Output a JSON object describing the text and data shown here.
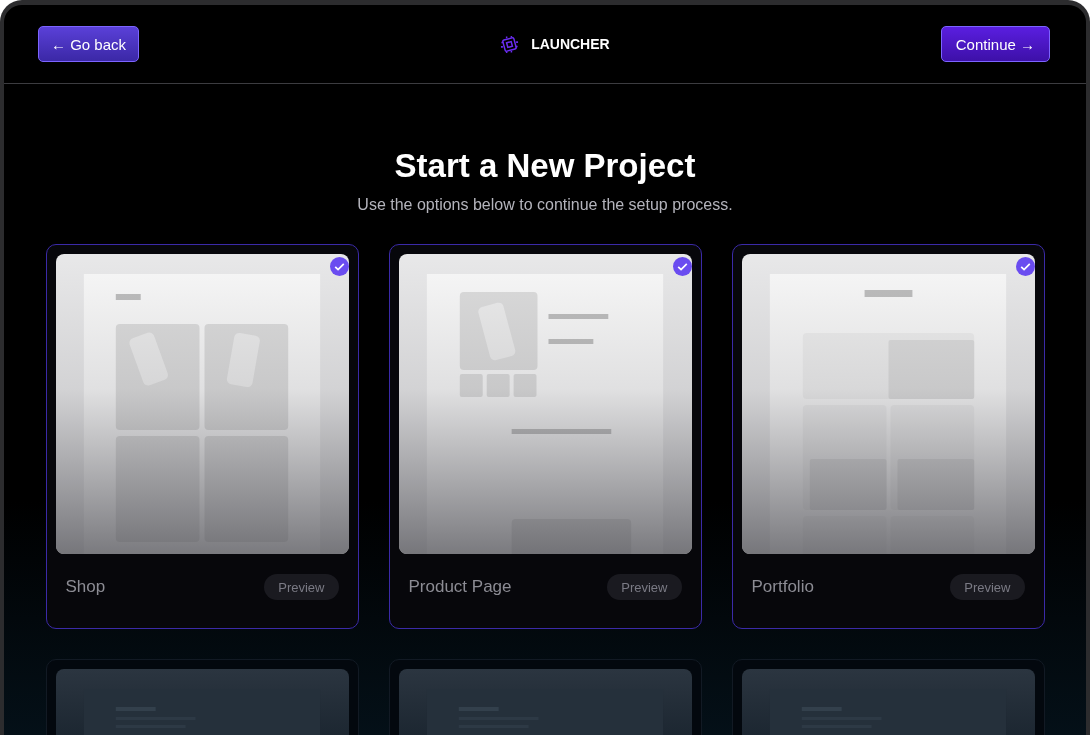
{
  "header": {
    "back_button": "← Go back",
    "logo": "LAUNCHER",
    "continue_button": "Continue →"
  },
  "title": "Start a New Project",
  "subtitle": "Use the options below to continue the setup process.",
  "projects": [
    {
      "name": "Shop",
      "selected": true,
      "preview_button": "Preview",
      "kind": "shop"
    },
    {
      "name": "Product Page",
      "selected": true,
      "preview_button": "Preview",
      "kind": "product"
    },
    {
      "name": "Portfolio",
      "selected": true,
      "preview_button": "Preview",
      "kind": "portfolio"
    }
  ]
}
